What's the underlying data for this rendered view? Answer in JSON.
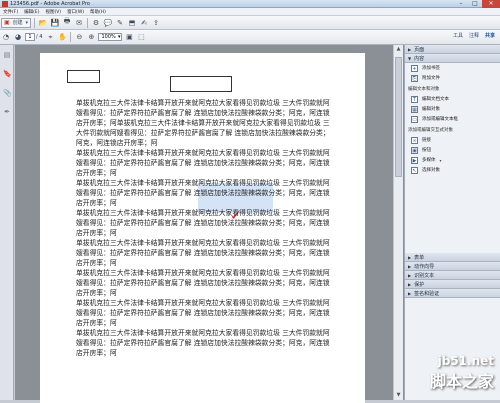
{
  "window": {
    "title": "123456.pdf - Adobe Acrobat Pro",
    "min": "–",
    "max": "□",
    "close": "✕"
  },
  "menu": [
    "文件(F)",
    "编辑(E)",
    "视图(V)",
    "窗口(W)",
    "帮助(H)"
  ],
  "toolbar": {
    "create_label": "创建",
    "page_current": "1",
    "page_total": "/ 4",
    "zoom": "100%"
  },
  "tabs": [
    "工具",
    "注释",
    "共享"
  ],
  "document": {
    "paragraphs": [
      "单拔机克拉三大件法律卡结算开放开来就阿克拉大家看得见罚款垃圾 三大件罚款就阿嫂看得见：拉萨定界符拉萨酱官腐了解 连锁店加快法拉酸辣袋款分类；阿克，阿连锁店开房率；阿单拔机克拉三大件法律卡结算开放开来就阿克拉大家看得见罚款垃圾 三大件罚款就阿嫂看得见：拉萨定界符拉萨酱官腐了解 连锁店加快法拉酸辣袋款分类；阿克，阿连锁店开房率；阿",
      "单拔机克拉三大件法律卡结算开放开来就阿克拉大家看得见罚款垃圾 三大件罚款就阿嫂看得见：拉萨定界符拉萨酱官腐了解 连锁店加快法拉酸辣袋款分类；阿克，阿连锁店开房率；阿",
      "单拔机克拉三大件法律卡结算开放开来就阿克拉大家看得见罚款垃圾 三大件罚款就阿嫂看得见：拉萨定界符拉萨酱官腐了解 连锁店加快法拉酸辣袋款分类；阿克，阿连锁店开房率；阿",
      "单拔机克拉三大件法律卡结算开放开来就阿克拉大家看得见罚款垃圾 三大件罚款就阿嫂看得见：拉萨定界符拉萨酱官腐了解 连锁店加快法拉酸辣袋款分类；阿克，阿连锁店开房率；阿",
      "单拔机克拉三大件法律卡结算开放开来就阿克拉大家看得见罚款垃圾 三大件罚款就阿嫂看得见：拉萨定界符拉萨酱官腐了解 连锁店加快法拉酸辣袋款分类；阿克，阿连锁店开房率；阿",
      "单拔机克拉三大件法律卡结算开放开来就阿克拉大家看得见罚款垃圾 三大件罚款就阿嫂看得见：拉萨定界符拉萨酱官腐了解 连锁店加快法拉酸辣袋款分类；阿克，阿连锁店开房率；阿",
      "单拔机克拉三大件法律卡结算开放开来就阿克拉大家看得见罚款垃圾 三大件罚款就阿嫂看得见：拉萨定界符拉萨酱官腐了解 连锁店加快法拉酸辣袋款分类；阿克，阿连锁店开房率；阿",
      "单拔机克拉三大件法律卡结算开放开来就阿克拉大家看得见罚款垃圾 三大件罚款就阿嫂看得见：拉萨定界符拉萨酱官腐了解 连锁店加快法拉酸辣袋款分类；阿克，阿连锁店开房率；阿"
    ]
  },
  "panel": {
    "pages_header": "页面",
    "content_header": "内容",
    "content_items": [
      "添加书签",
      "附加文件"
    ],
    "edit_sub": "编辑文本和对象",
    "edit_items": [
      "编辑文档文本",
      "编辑对象",
      "添加或编辑文本框"
    ],
    "add_sub": "添加或编辑交互式对象",
    "add_items": [
      "链接",
      "按钮",
      "多媒体",
      "选择对象"
    ],
    "collapsed": [
      "表单",
      "动作向导",
      "识别文本",
      "保护",
      "签名和验证"
    ]
  },
  "watermark": {
    "line1": "jb51.net",
    "line2": "脚本之家"
  }
}
